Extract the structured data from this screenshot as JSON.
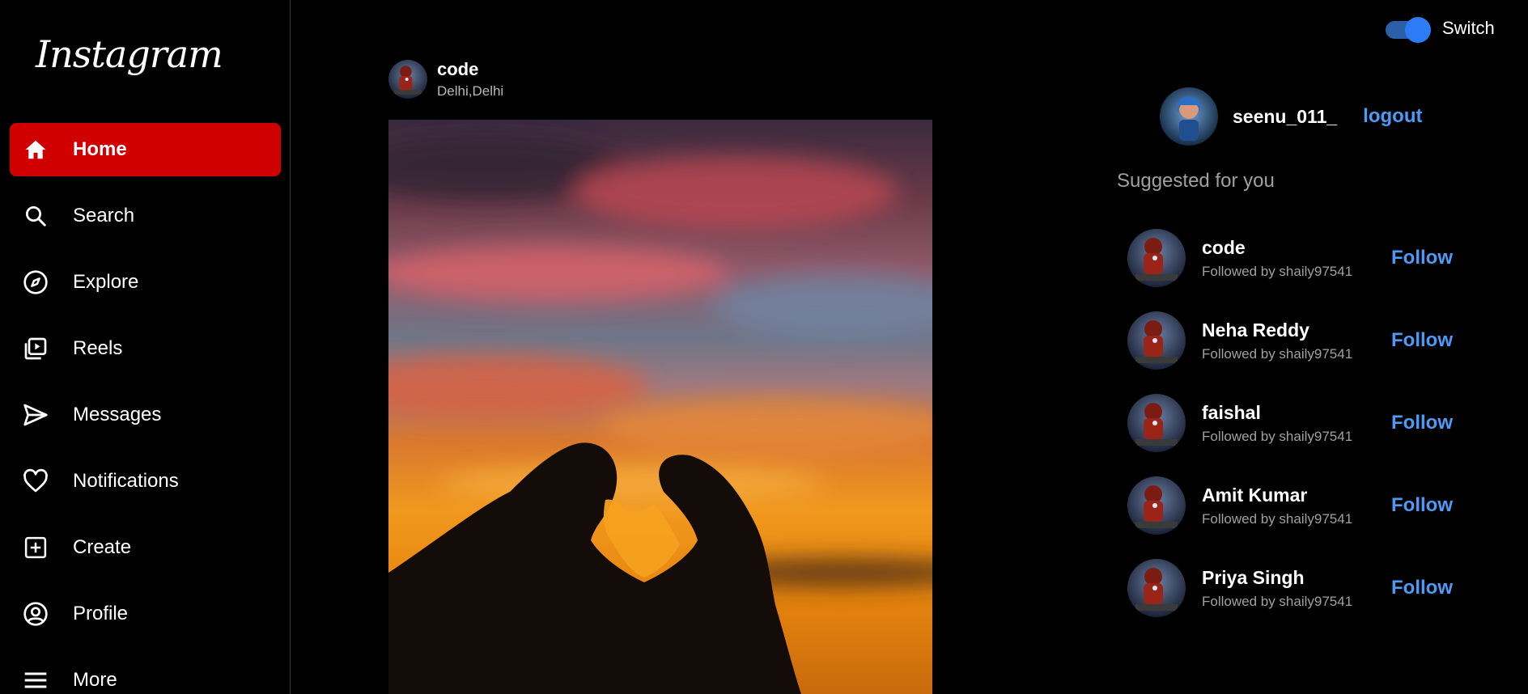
{
  "app": {
    "logo_text": "Instagram",
    "accent_color": "#d10000",
    "link_color": "#4e9af7"
  },
  "sidebar": {
    "items": [
      {
        "label": "Home",
        "icon": "home-icon",
        "active": true
      },
      {
        "label": "Search",
        "icon": "search-icon"
      },
      {
        "label": "Explore",
        "icon": "compass-icon"
      },
      {
        "label": "Reels",
        "icon": "reels-icon"
      },
      {
        "label": "Messages",
        "icon": "send-icon"
      },
      {
        "label": "Notifications",
        "icon": "heart-icon"
      },
      {
        "label": "Create",
        "icon": "plus-square-icon"
      },
      {
        "label": "Profile",
        "icon": "user-circle-icon"
      },
      {
        "label": "More",
        "icon": "menu-icon"
      }
    ]
  },
  "post": {
    "username": "code",
    "location": "Delhi,Delhi"
  },
  "switch": {
    "label": "Switch",
    "on": true
  },
  "current_user": {
    "username": "seenu_011_",
    "logout_label": "logout"
  },
  "suggestions": {
    "title": "Suggested for you",
    "follow_label": "Follow",
    "items": [
      {
        "name": "code",
        "subtitle": "Followed by shaily97541"
      },
      {
        "name": "Neha Reddy",
        "subtitle": "Followed by shaily97541"
      },
      {
        "name": "faishal",
        "subtitle": "Followed by shaily97541"
      },
      {
        "name": "Amit Kumar",
        "subtitle": "Followed by shaily97541"
      },
      {
        "name": "Priya Singh",
        "subtitle": "Followed by shaily97541"
      }
    ]
  }
}
